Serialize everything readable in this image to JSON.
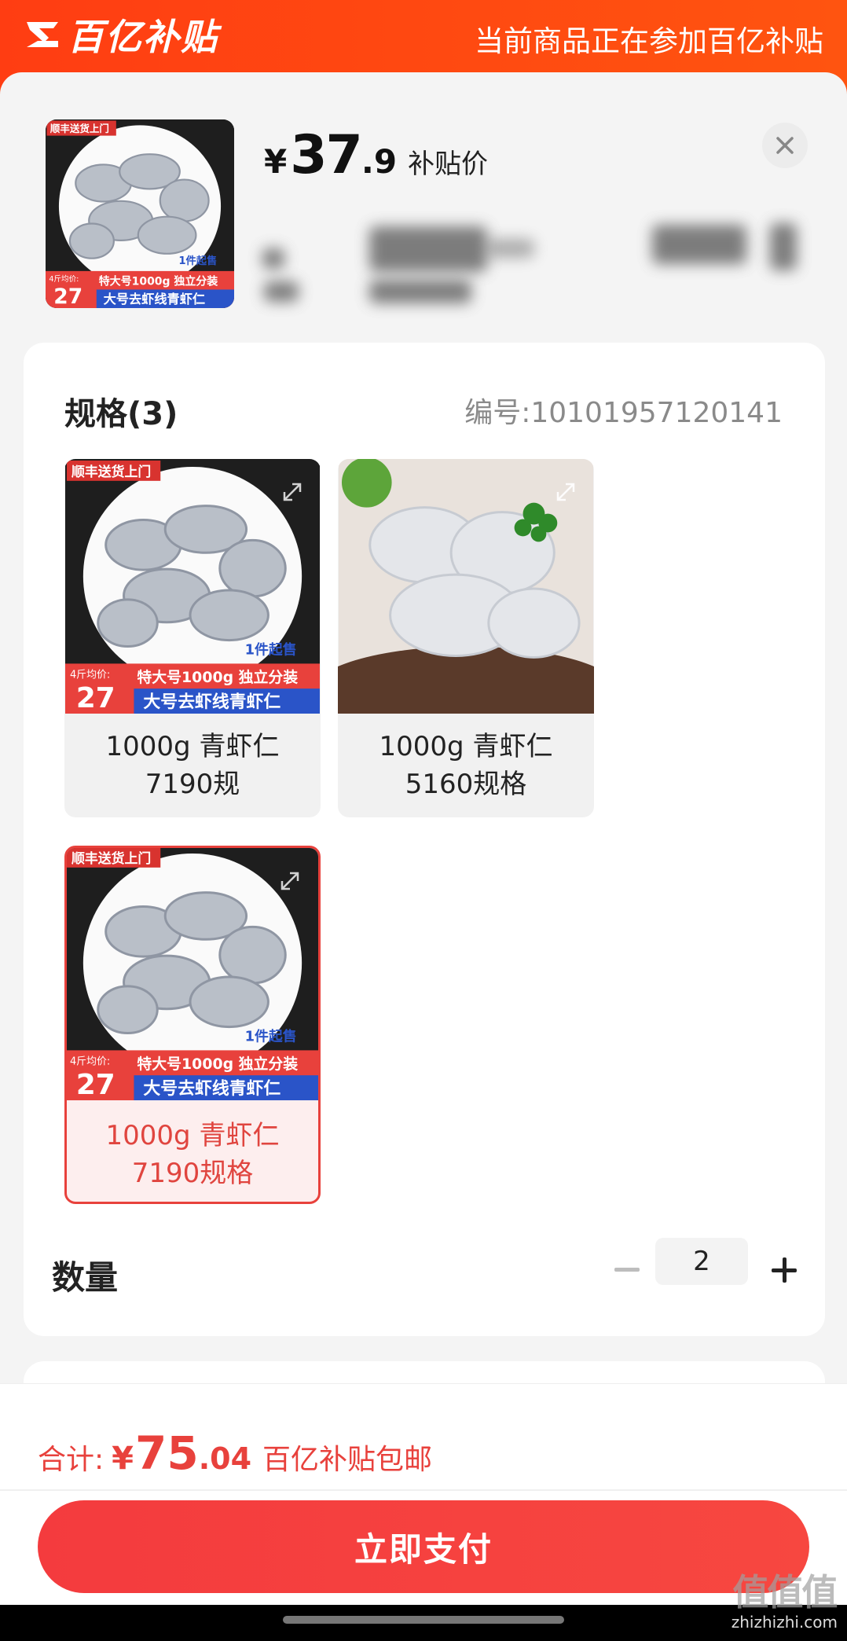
{
  "banner": {
    "logo_text": "百亿补贴",
    "right_text": "当前商品正在参加百亿补贴"
  },
  "product": {
    "currency": "¥",
    "price_int": "37",
    "price_dec": ".9",
    "price_tag": "补贴价",
    "image_badges": {
      "top_left": "顺丰送货上门",
      "min_qty": "1件起售",
      "avg_price_label": "4斤均价:",
      "avg_price": "27",
      "size_line": "特大号1000g 独立分装",
      "name_line": "大号去虾线青虾仁"
    }
  },
  "spec": {
    "title": "规格(3)",
    "code": "编号:10101957120141",
    "options": [
      {
        "label": "1000g 青虾仁 7190规",
        "selected": false
      },
      {
        "label": "1000g 青虾仁 5160规格",
        "selected": false
      },
      {
        "label": "1000g 青虾仁 7190规格",
        "selected": true
      }
    ]
  },
  "quantity": {
    "label": "数量",
    "value": "2"
  },
  "footer": {
    "total_label": "合计:",
    "currency": "¥",
    "total_int": "75",
    "total_dec": ".04",
    "shipping_note": "百亿补贴包邮",
    "pay_button": "立即支付"
  },
  "watermark": {
    "main": "值值值",
    "sub": "zhizhizhi.com"
  },
  "colors": {
    "brand": "#ff4a12",
    "accent_red": "#e8413c",
    "pay_button": "#f43b3e"
  }
}
